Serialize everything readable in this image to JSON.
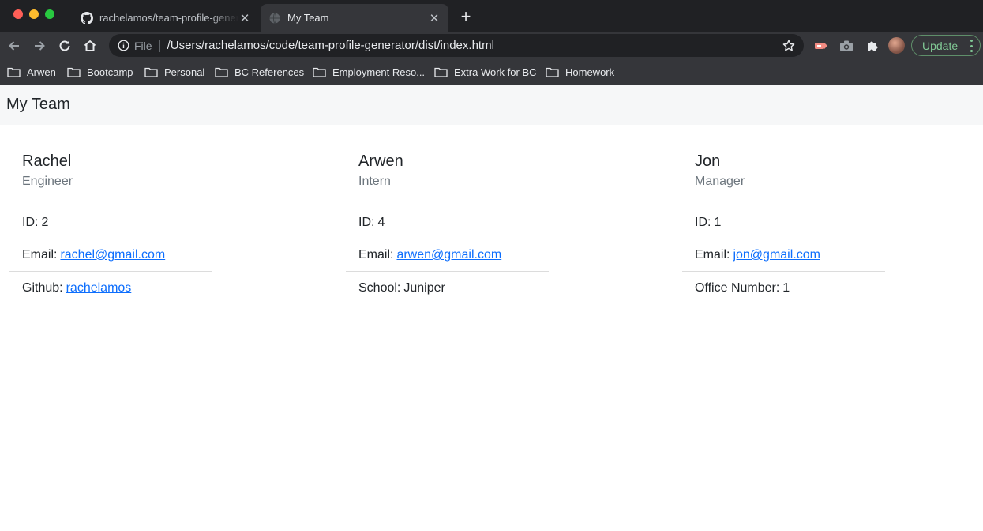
{
  "browser": {
    "tabs": [
      {
        "title": "rachelamos/team-profile-generator",
        "active": false,
        "icon": "github-icon"
      },
      {
        "title": "My Team",
        "active": true,
        "icon": "globe-icon"
      }
    ],
    "omnibox": {
      "scheme": "File",
      "url": "/Users/rachelamos/code/team-profile-generator/dist/index.html"
    },
    "update_label": "Update",
    "bookmarks": [
      {
        "label": "Arwen"
      },
      {
        "label": "Bootcamp"
      },
      {
        "label": "Personal"
      },
      {
        "label": "BC References"
      },
      {
        "label": "Employment Reso..."
      },
      {
        "label": "Extra Work for BC"
      },
      {
        "label": "Homework"
      }
    ]
  },
  "page": {
    "title": "My Team",
    "cards": [
      {
        "name": "Rachel",
        "role": "Engineer",
        "id_label": "ID:",
        "id_value": "2",
        "email_label": "Email:",
        "email": "rachel@gmail.com",
        "extra_label": "Github:",
        "extra_value": "rachelamos",
        "extra_is_link": true
      },
      {
        "name": "Arwen",
        "role": "Intern",
        "id_label": "ID:",
        "id_value": "4",
        "email_label": "Email:",
        "email": "arwen@gmail.com",
        "extra_label": "School:",
        "extra_value": "Juniper",
        "extra_is_link": false
      },
      {
        "name": "Jon",
        "role": "Manager",
        "id_label": "ID:",
        "id_value": "1",
        "email_label": "Email:",
        "email": "jon@gmail.com",
        "extra_label": "Office Number:",
        "extra_value": "1",
        "extra_is_link": false
      }
    ]
  },
  "colors": {
    "link": "#0d6efd",
    "header_bg": "#f6f7f8",
    "muted_text": "#6c757d",
    "update_green": "#81c995"
  }
}
